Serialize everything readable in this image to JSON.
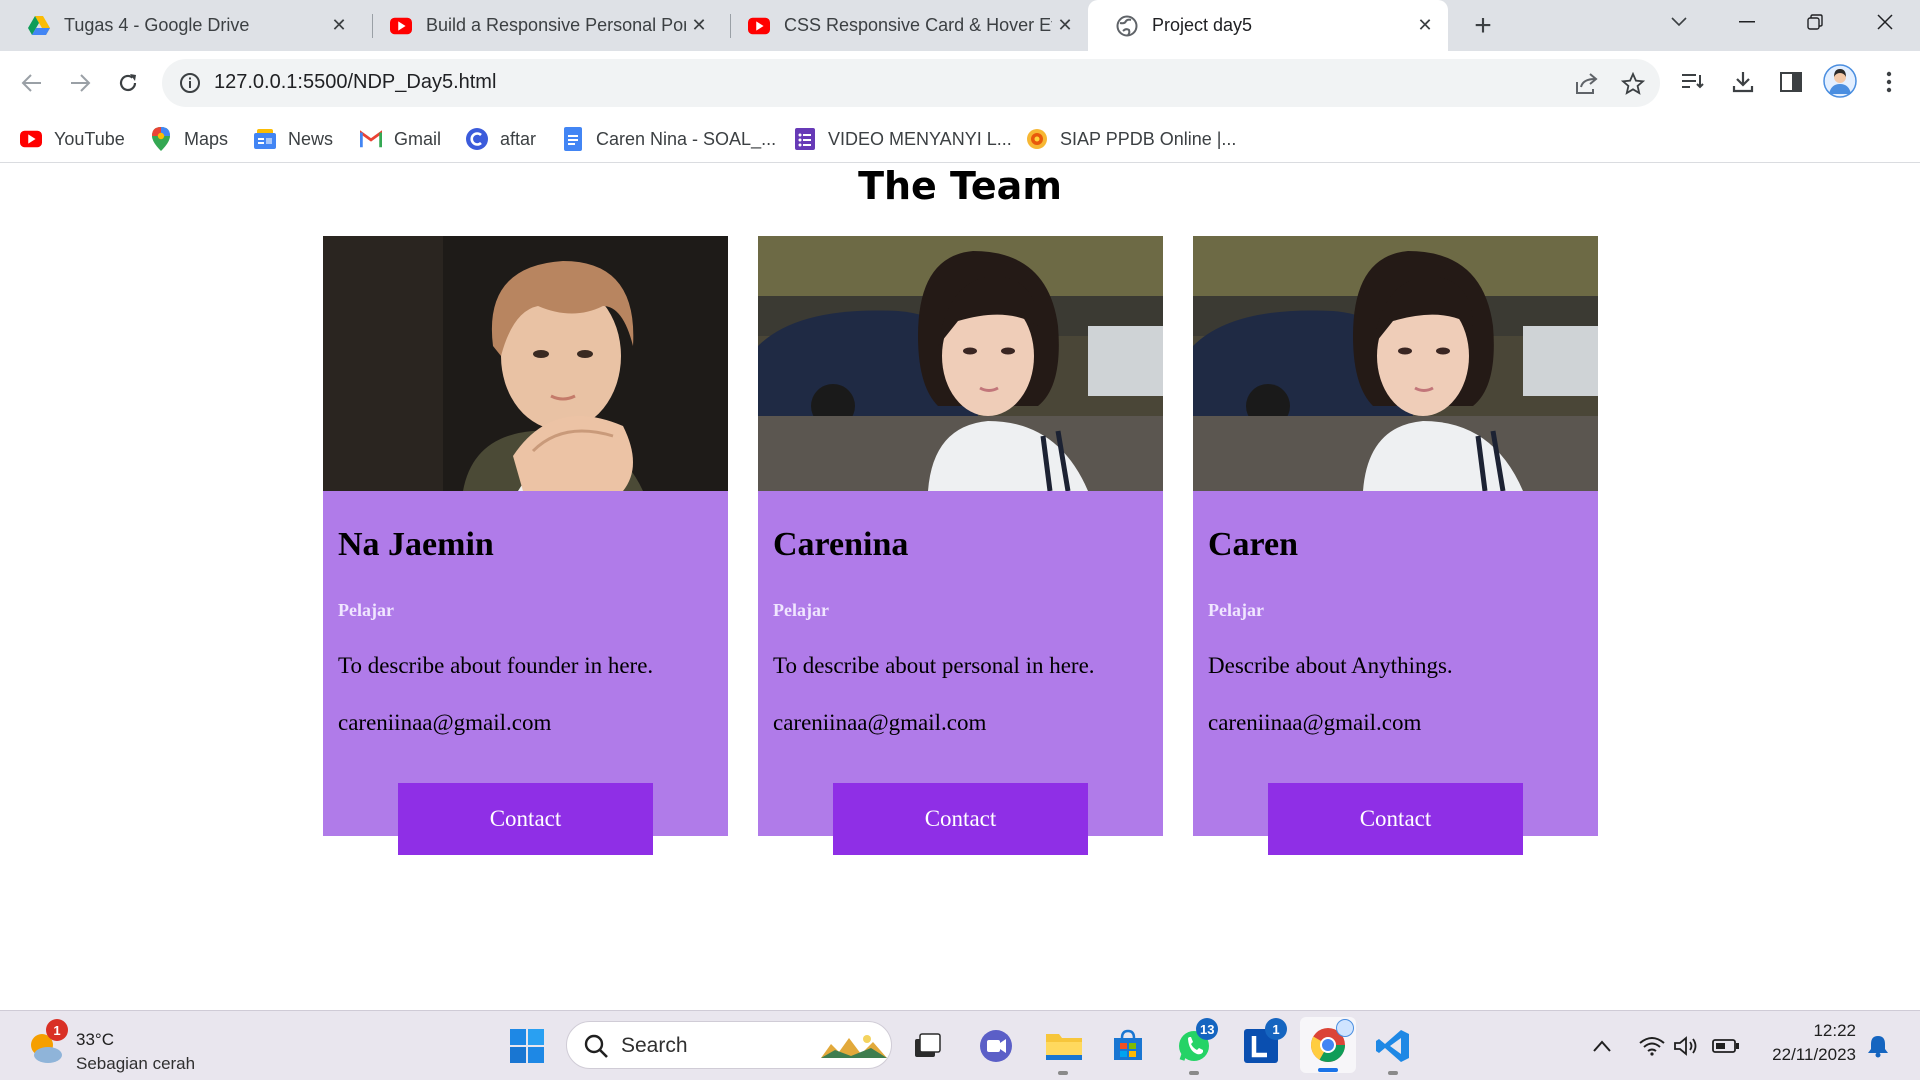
{
  "browser": {
    "tabs": [
      {
        "title": "Tugas 4 - Google Drive",
        "icon": "google-drive-icon",
        "active": false
      },
      {
        "title": "Build a Responsive Personal Port",
        "icon": "youtube-icon",
        "active": false
      },
      {
        "title": "CSS Responsive Card & Hover Ef",
        "icon": "youtube-icon",
        "active": false
      },
      {
        "title": "Project day5",
        "icon": "globe-icon",
        "active": true
      }
    ],
    "url_host": "127.0.0.1",
    "url_rest": ":5500/NDP_Day5.html",
    "bookmarks": [
      {
        "label": "YouTube",
        "icon": "youtube-icon"
      },
      {
        "label": "Maps",
        "icon": "maps-pin-icon"
      },
      {
        "label": "News",
        "icon": "news-icon"
      },
      {
        "label": "Gmail",
        "icon": "gmail-icon"
      },
      {
        "label": "aftar",
        "icon": "c-logo-icon"
      },
      {
        "label": "Caren Nina - SOAL_...",
        "icon": "docs-icon"
      },
      {
        "label": "VIDEO MENYANYI L...",
        "icon": "forms-icon"
      },
      {
        "label": "SIAP PPDB Online |...",
        "icon": "siap-icon"
      }
    ]
  },
  "page": {
    "title": "The Team",
    "cards": [
      {
        "name": "Na Jaemin",
        "role": "Pelajar",
        "description": "To describe about founder in here.",
        "email": "careniinaa@gmail.com",
        "button": "Contact",
        "photo": "male-portrait"
      },
      {
        "name": "Carenina",
        "role": "Pelajar",
        "description": "To describe about personal in here.",
        "email": "careniinaa@gmail.com",
        "button": "Contact",
        "photo": "female-portrait"
      },
      {
        "name": "Caren",
        "role": "Pelajar",
        "description": "Describe about Anythings.",
        "email": "careniinaa@gmail.com",
        "button": "Contact",
        "photo": "female-portrait"
      }
    ],
    "colors": {
      "card_body": "#b07be9",
      "button": "#8f2fe6"
    }
  },
  "taskbar": {
    "weather_temp": "33°C",
    "weather_condition": "Sebagian cerah",
    "weather_badge": "1",
    "search_label": "Search",
    "whatsapp_badge": "13",
    "line_badge": "1",
    "time": "12:22",
    "date": "22/11/2023"
  }
}
